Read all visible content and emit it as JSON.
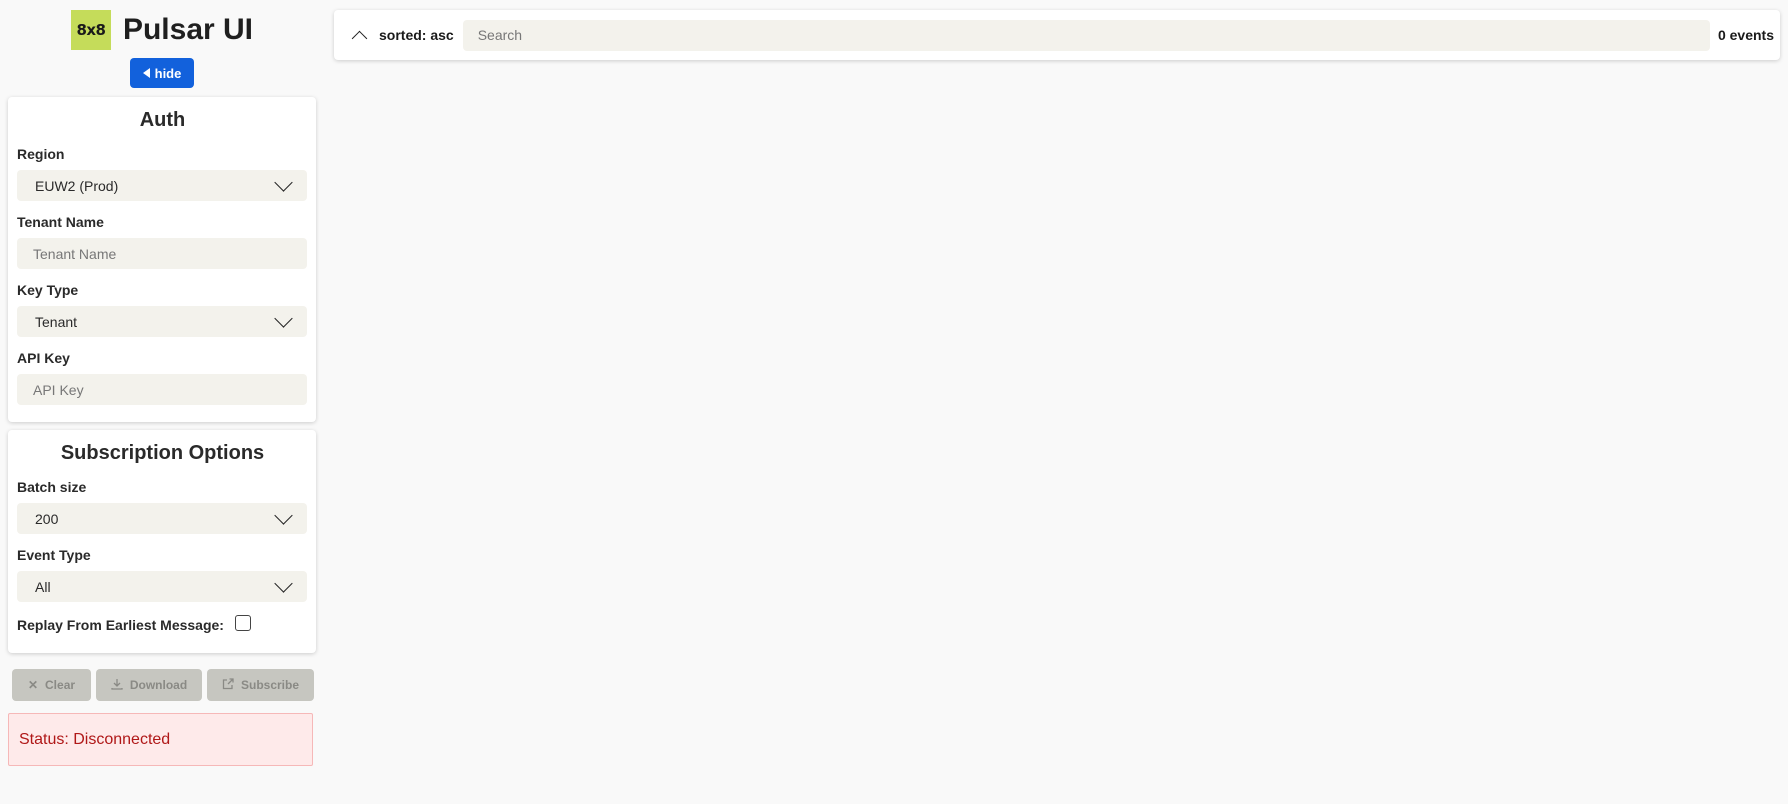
{
  "brand": {
    "logo_text": "8x8",
    "title": "Pulsar UI",
    "logo_color": "#c5dc5a"
  },
  "hide_button": {
    "label": "hide"
  },
  "auth": {
    "title": "Auth",
    "region": {
      "label": "Region",
      "value": "EUW2 (Prod)"
    },
    "tenant_name": {
      "label": "Tenant Name",
      "placeholder": "Tenant Name"
    },
    "key_type": {
      "label": "Key Type",
      "value": "Tenant"
    },
    "api_key": {
      "label": "API Key",
      "placeholder": "API Key"
    }
  },
  "subscription": {
    "title": "Subscription Options",
    "batch_size": {
      "label": "Batch size",
      "value": "200"
    },
    "event_type": {
      "label": "Event Type",
      "value": "All"
    },
    "replay": {
      "label": "Replay From Earliest Message:",
      "checked": false
    }
  },
  "actions": {
    "clear": "Clear",
    "download": "Download",
    "subscribe": "Subscribe"
  },
  "status": {
    "text": "Status: Disconnected",
    "color": "#b01818"
  },
  "toolbar": {
    "sorted": "sorted: asc",
    "search_placeholder": "Search",
    "events_count": "0 events"
  },
  "colors": {
    "primary": "#1261dc",
    "disabled": "#c6c6c0"
  },
  "icons": {
    "hide": "caret-left-icon",
    "select": "chevron-down-icon",
    "sort": "chevron-up-icon",
    "clear": "close-icon",
    "download": "download-icon",
    "subscribe": "subscribe-icon"
  }
}
